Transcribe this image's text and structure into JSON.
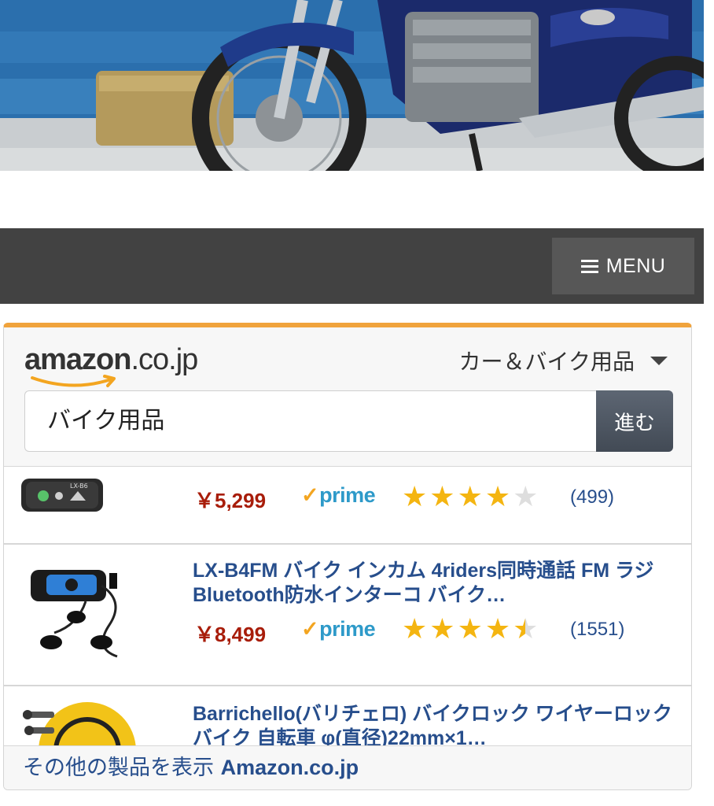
{
  "nav": {
    "menu_label": "MENU"
  },
  "widget": {
    "brand": "amazon",
    "brand_domain": ".co.jp",
    "category": "カー＆バイク用品",
    "search_value": "バイク用品",
    "go_label": "進む",
    "accent_color": "#f0a33c",
    "items": [
      {
        "title": "",
        "price": "￥5,299",
        "prime": "prime",
        "rating": 4.0,
        "reviews": "(499)",
        "icon": "intercom-device-icon"
      },
      {
        "title": "LX-B4FM バイク インカム 4riders同時通話 FM ラジ Bluetooth防水インターコ バイク…",
        "price": "￥8,499",
        "prime": "prime",
        "rating": 4.5,
        "reviews": "(1551)",
        "icon": "bluetooth-intercom-headset-icon"
      },
      {
        "title": "Barrichello(バリチェロ) バイクロック ワイヤーロック バイク 自転車 φ(直径)22mm×1…",
        "icon": "wire-lock-icon"
      }
    ],
    "footer_text": "その他の製品を表示",
    "footer_brand": "Amazon.co.jp"
  }
}
